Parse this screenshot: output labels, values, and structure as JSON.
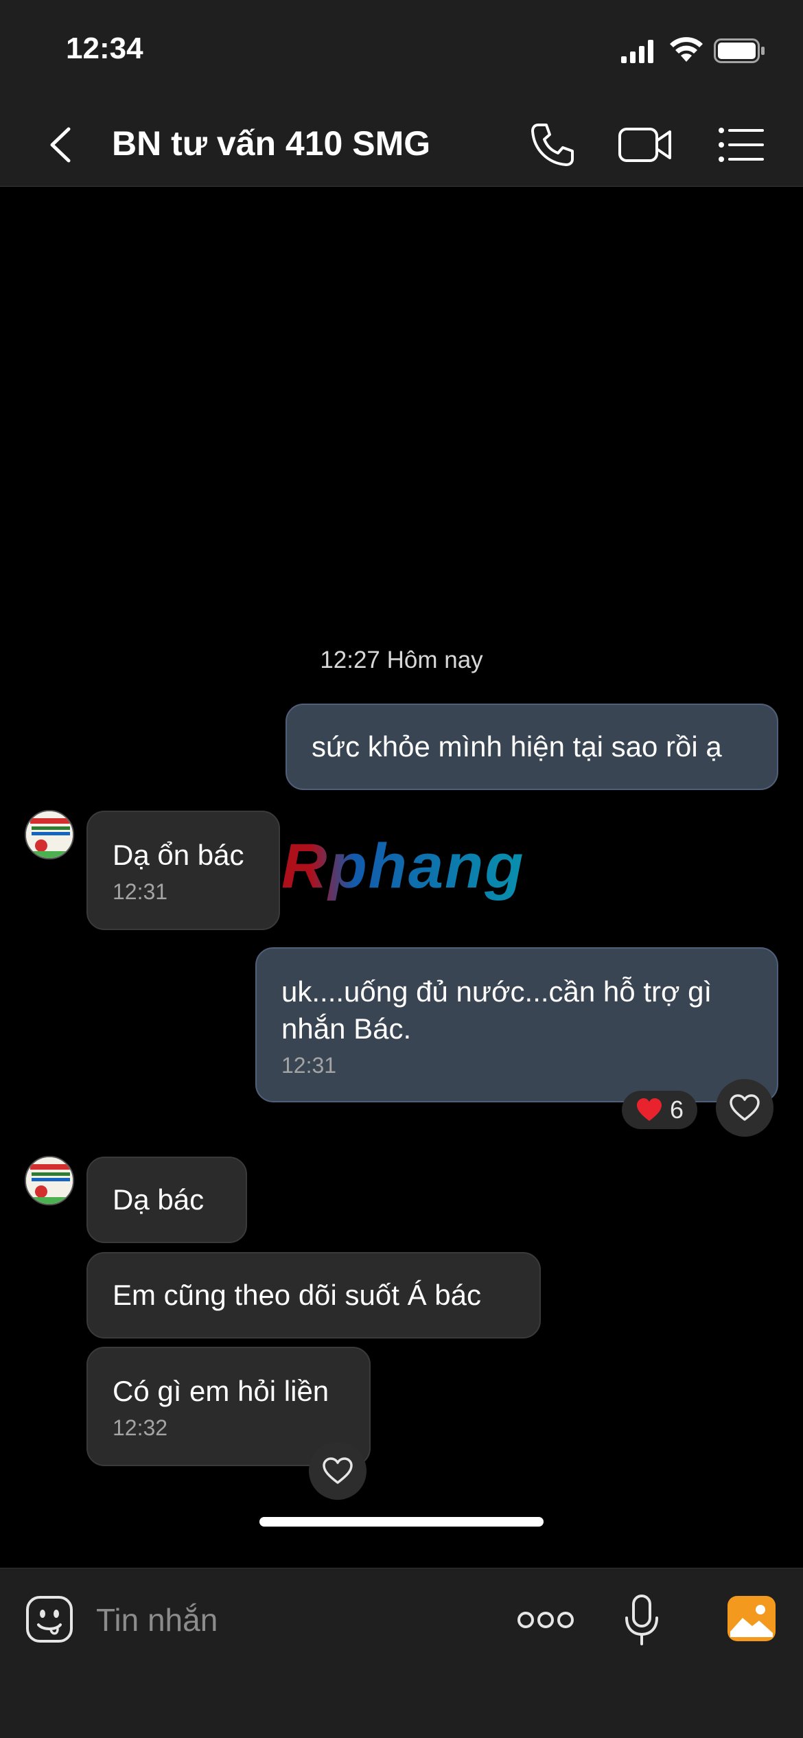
{
  "status_bar": {
    "time": "12:34"
  },
  "header": {
    "title": "BN tư vấn 410 SMG"
  },
  "conversation": {
    "time_divider": "12:27 Hôm nay",
    "messages": [
      {
        "direction": "out",
        "text": "sức khỏe mình hiện tại sao rồi ạ",
        "time": ""
      },
      {
        "direction": "in",
        "text": "Dạ ổn bác",
        "time": "12:31"
      },
      {
        "direction": "out",
        "text": "uk....uống đủ nước...cần hỗ trợ gì nhắn Bác.",
        "time": "12:31",
        "reaction": {
          "emoji": "❤️",
          "count": "6"
        }
      },
      {
        "direction": "in",
        "text": "Dạ bác",
        "time": ""
      },
      {
        "direction": "in",
        "text": "Em cũng theo dõi suốt Á bác",
        "time": ""
      },
      {
        "direction": "in",
        "text": "Có gì em hỏi liền",
        "time": "12:32"
      }
    ]
  },
  "watermark": "Rphang",
  "composer": {
    "placeholder": "Tin nhắn"
  },
  "colors": {
    "outgoing_bubble": "#3a4554",
    "incoming_bubble": "#2b2b2b",
    "image_button": "#f39a1e",
    "heart": "#e8232e"
  }
}
